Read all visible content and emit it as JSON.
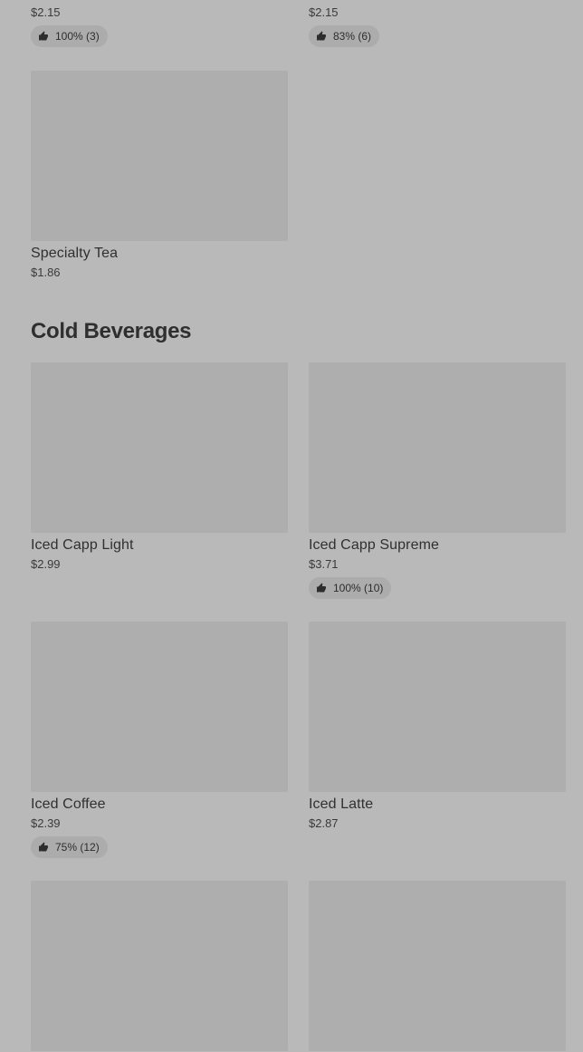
{
  "colors": {
    "background": "#b9b9b9",
    "image_placeholder": "#aeaeae",
    "badge_background": "#acacac",
    "text": "#2d2d2d"
  },
  "icons": {
    "rating": "thumbs-up-icon"
  },
  "previous_section": {
    "items": [
      {
        "price": "$2.15",
        "rating": "100% (3)"
      },
      {
        "price": "$2.15",
        "rating": "83% (6)"
      },
      {
        "name": "Specialty Tea",
        "price": "$1.86"
      }
    ]
  },
  "cold_beverages": {
    "title": "Cold Beverages",
    "items": [
      {
        "name": "Iced Capp Light",
        "price": "$2.99"
      },
      {
        "name": "Iced Capp Supreme",
        "price": "$3.71",
        "rating": "100% (10)"
      },
      {
        "name": "Iced Coffee",
        "price": "$2.39",
        "rating": "75% (12)"
      },
      {
        "name": "Iced Latte",
        "price": "$2.87"
      }
    ]
  }
}
